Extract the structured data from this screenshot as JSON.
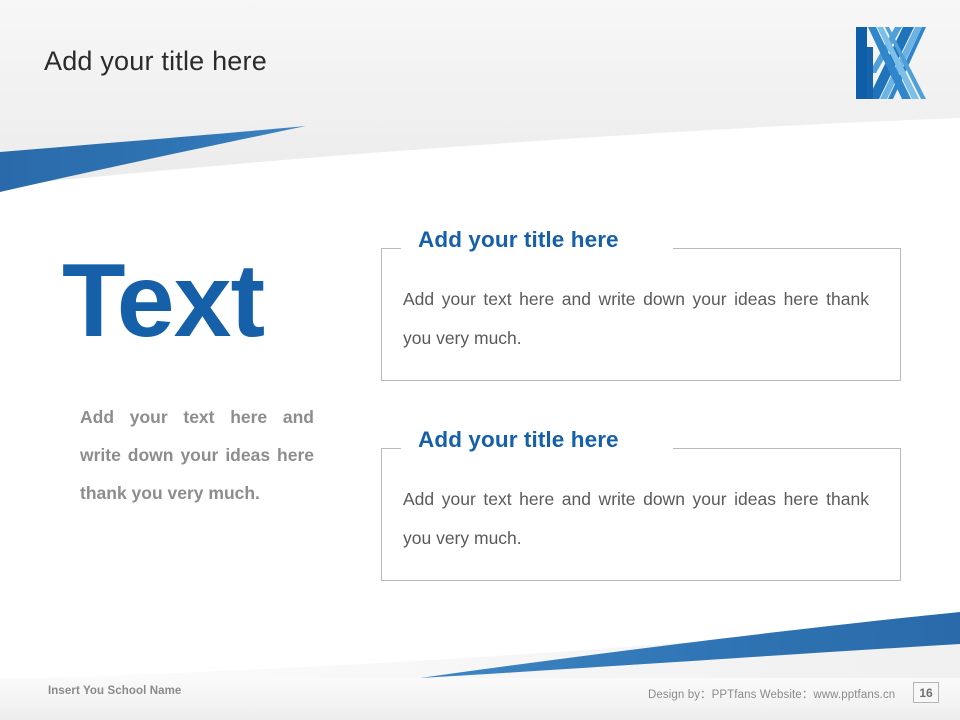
{
  "slide": {
    "title": "Add your title here",
    "logo_name": "stylized-k-logo"
  },
  "left_panel": {
    "headline": "Text",
    "body": "Add your text here and write down your ideas here thank you very much."
  },
  "content_boxes": [
    {
      "title": "Add your title here",
      "body": "Add your text here and write down your ideas here thank you very much."
    },
    {
      "title": "Add your title here",
      "body": "Add your text here and write down your ideas here thank you very much."
    }
  ],
  "footer": {
    "school_name": "Insert You School Name",
    "credit": "Design by：PPTfans  Website：www.pptfans.cn",
    "page_number": "16"
  },
  "colors": {
    "accent_blue": "#1560a8",
    "swoosh_blue": "#2d6fae",
    "body_gray": "#5a5a5a",
    "muted_gray": "#8d8d8d",
    "border_gray": "#b9b9b9"
  }
}
